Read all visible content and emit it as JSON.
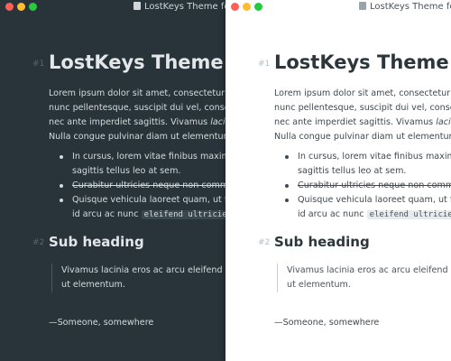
{
  "window_title": "LostKeys Theme for Typora",
  "heading1": {
    "number": "#1",
    "text": "LostKeys Theme for Typora"
  },
  "paragraph": {
    "line1": "Lorem ipsum dolor sit amet, consectetur adipiscing elit.",
    "line2": "nunc pellentesque, suscipit dui vel, consectetur",
    "line3_prefix": "nec ante imperdiet sagittis. Vivamus ",
    "line3_italic": "lacinia",
    "line4": "Nulla congue pulvinar diam ut elementum."
  },
  "list": {
    "item1_line1": "In cursus, lorem vitae finibus maximus,",
    "item1_line2": "sagittis tellus leo at sem.",
    "item2": "Curabitur ultricies neque non commodo",
    "item3_line1": "Quisque vehicula laoreet quam, ut fringilla",
    "item3_line2_prefix": "id arcu ac nunc ",
    "item3_code": "eleifend ultricies"
  },
  "heading2": {
    "number": "#2",
    "text": "Sub heading"
  },
  "blockquote": {
    "line1": "Vivamus lacinia eros ac arcu eleifend luctus",
    "line2": "ut elementum."
  },
  "attribution": "—Someone, somewhere",
  "colors": {
    "dark_background": "#28343a",
    "light_background": "#ffffff",
    "close": "#fe5f57",
    "minimize": "#febc2e",
    "zoom": "#28c840"
  }
}
